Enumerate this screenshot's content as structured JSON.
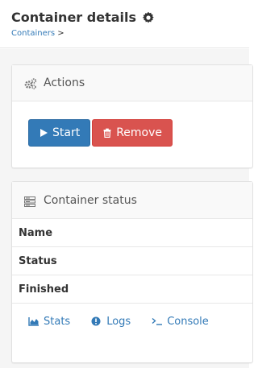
{
  "header": {
    "title": "Container details",
    "title_icon": "gear-icon",
    "breadcrumb": {
      "link": "Containers",
      "separator": ">"
    }
  },
  "actions_panel": {
    "title": "Actions",
    "icon": "cogs-icon",
    "buttons": {
      "start": {
        "label": "Start",
        "icon": "play-icon",
        "color": "#337ab7"
      },
      "remove": {
        "label": "Remove",
        "icon": "trash-icon",
        "color": "#d9534f"
      }
    }
  },
  "status_panel": {
    "title": "Container status",
    "icon": "server-icon",
    "rows": [
      {
        "label": "Name"
      },
      {
        "label": "Status"
      },
      {
        "label": "Finished"
      }
    ],
    "links": [
      {
        "label": "Stats",
        "icon": "area-chart-icon"
      },
      {
        "label": "Logs",
        "icon": "exclamation-circle-icon"
      },
      {
        "label": "Console",
        "icon": "terminal-icon"
      }
    ]
  },
  "colors": {
    "link": "#337ab7",
    "primary": "#337ab7",
    "danger": "#d9534f",
    "page_background": "#f5f5f5"
  }
}
